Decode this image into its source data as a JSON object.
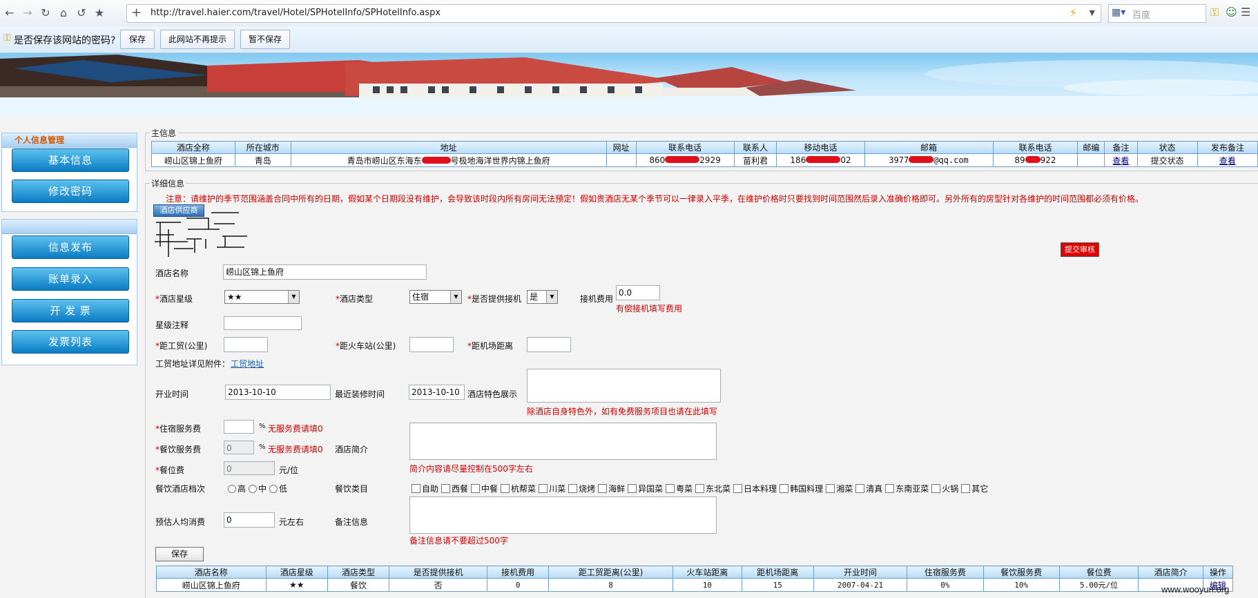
{
  "browser": {
    "url": "http://travel.haier.com/travel/Hotel/SPHotelInfo/SPHotelInfo.aspx",
    "search_placeholder": "百度"
  },
  "password_bar": {
    "question": "是否保存该网站的密码?",
    "save": "保存",
    "never": "此网站不再提示",
    "not_now": "暂不保存"
  },
  "sidebar": {
    "panel1_title": "个人信息管理",
    "basic_info": "基本信息",
    "change_password": "修改密码",
    "publish": "信息发布",
    "bill_entry": "账单录入",
    "invoice": "开 发 票",
    "invoice_list": "发票列表"
  },
  "main_info": {
    "legend": "主信息",
    "headers": [
      "酒店全称",
      "所在城市",
      "地址",
      "网址",
      "联系电话",
      "联系人",
      "移动电话",
      "邮箱",
      "联系电话",
      "邮编",
      "备注",
      "状态",
      "发布备注"
    ],
    "row": {
      "name": "崂山区锦上鱼府",
      "city": "青岛",
      "address_a": "青岛市崂山区东海东",
      "address_b": "号极地海洋世界内锦上鱼府",
      "website": "",
      "phone_a": "860",
      "phone_b": "2929",
      "contact": "苗利君",
      "mobile_a": "186",
      "mobile_b": "02",
      "email_a": "3977",
      "email_b": "@qq.com",
      "phone2_a": "89",
      "phone2_b": "922",
      "zip": "",
      "note": "查看",
      "status": "提交状态",
      "pub_note": "查看"
    }
  },
  "detail": {
    "legend": "详细信息",
    "notice": "注意：请维护的季节范围涵盖合同中所有的日期，假如某个日期段没有维护，会导致该时段内所有房间无法预定！假如贵酒店无某个季节可以一律录入平季，在维护价格时只要找到时间范围然后录入准确价格即可。另外所有的房型针对各维护的时间范围都必须有价格。",
    "supplier_tab": "酒店供应商",
    "submit_audit": "提交审核",
    "hotel_name_label": "酒店名称",
    "hotel_name_value": "崂山区锦上鱼府",
    "star_label": "酒店星级",
    "star_value": "★★",
    "type_label": "酒店类型",
    "type_value": "住宿",
    "pickup_label": "是否提供接机",
    "pickup_value": "是",
    "pickup_fee_label": "接机费用",
    "pickup_fee_value": "0.0",
    "pickup_fee_hint": "有偿接机填写费用",
    "star_note_label": "星级注释",
    "dist_gm_label": "距工贸(公里)",
    "dist_train_label": "距火车站(公里)",
    "dist_airport_label": "距机场距离",
    "gm_attach_label": "工贸地址详见附件：",
    "gm_attach_link": "工贸地址",
    "open_label": "开业时间",
    "open_value": "2013-10-10",
    "renov_label": "最近装修时间",
    "renov_value": "2013-10-10",
    "feature_label": "酒店特色展示",
    "feature_hint": "除酒店自身特色外，如有免费服务项目也请在此填写",
    "room_fee_label": "住宿服务费",
    "room_fee_hint": "无服务费请填0",
    "dining_fee_label": "餐饮服务费",
    "dining_fee_value": "0",
    "dining_fee_hint": "无服务费请填0",
    "intro_label": "酒店简介",
    "intro_hint": "简介内容请尽量控制在500字左右",
    "seat_fee_label": "餐位费",
    "seat_fee_value": "0",
    "seat_fee_unit": "元/位",
    "percent": "%",
    "grade_label": "餐饮酒店档次",
    "grade_options": [
      "高",
      "中",
      "低"
    ],
    "cuisine_label": "餐饮类目",
    "cuisines": [
      "自助",
      "西餐",
      "中餐",
      "杭帮菜",
      "川菜",
      "烧烤",
      "海鲜",
      "异国菜",
      "粤菜",
      "东北菜",
      "日本料理",
      "韩国料理",
      "湘菜",
      "清真",
      "东南亚菜",
      "火锅",
      "其它"
    ],
    "avg_label": "预估人均消费",
    "avg_value": "0",
    "avg_unit": "元左右",
    "remark_label": "备注信息",
    "remark_hint": "备注信息请不要超过500字",
    "save_button": "保存"
  },
  "bottom_table": {
    "headers": [
      "酒店名称",
      "酒店星级",
      "酒店类型",
      "是否提供接机",
      "接机费用",
      "距工贸距离(公里)",
      "火车站距离",
      "距机场距离",
      "开业时间",
      "住宿服务费",
      "餐饮服务费",
      "餐位费",
      "酒店简介",
      "操作"
    ],
    "row": [
      "崂山区锦上鱼府",
      "★★",
      "餐饮",
      "否",
      "0",
      "8",
      "10",
      "15",
      "2007-04-21",
      "0%",
      "10%",
      "5.00元/位",
      "",
      "编辑"
    ]
  },
  "watermark": "www.wooyun.org"
}
